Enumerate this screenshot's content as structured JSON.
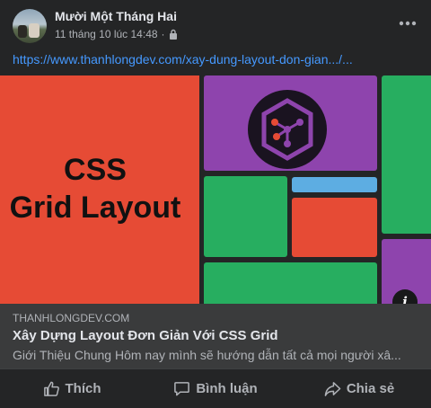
{
  "post": {
    "author": "Mười Một Tháng Hai",
    "timestamp": "11 tháng 10 lúc 14:48",
    "separator": "·",
    "privacy_icon": "lock-icon",
    "more_icon": "more-options-icon",
    "link_text": "https://www.thanhlongdev.com/xay-dung-layout-don-gian.../..."
  },
  "preview": {
    "hero_line1": "CSS",
    "hero_line2": "Grid Layout",
    "info_label": "i",
    "colors": {
      "red": "#e64b35",
      "purple": "#8e44ad",
      "green": "#27ae60",
      "blue": "#5dade2",
      "dark": "#1a1320"
    }
  },
  "link_card": {
    "domain": "THANHLONGDEV.COM",
    "title": "Xây Dựng Layout Đơn Giản Với CSS Grid",
    "description": "Giới Thiệu Chung Hôm nay mình sẽ hướng dẫn tất cả mọi người xâ..."
  },
  "actions": {
    "like": "Thích",
    "comment": "Bình luận",
    "share": "Chia sẻ"
  }
}
